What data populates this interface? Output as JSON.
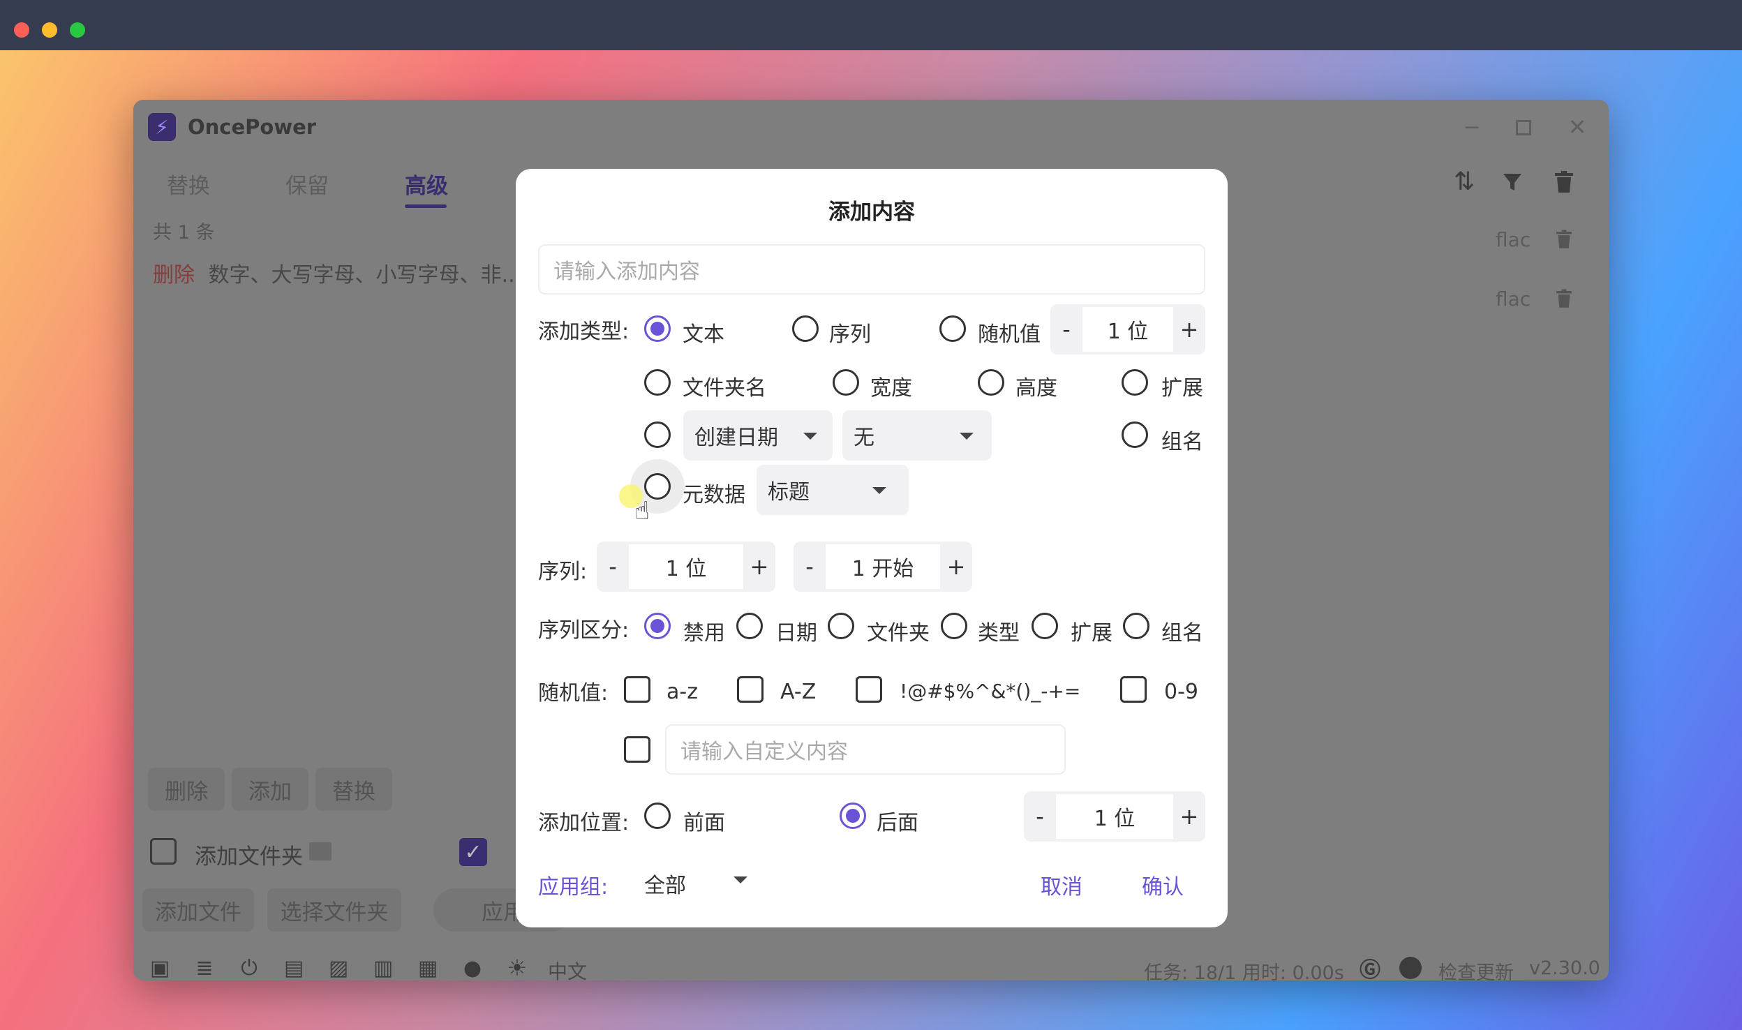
{
  "app": {
    "title": "OncePower",
    "tabs": [
      "替换",
      "保留",
      "高级"
    ],
    "count_text": "共 1 条",
    "rule": {
      "tag": "删除",
      "text": "数字、大写字母、小写字母、非..."
    },
    "file_ext_1": "flac",
    "file_ext_2": "flac",
    "action_buttons": [
      "删除",
      "添加",
      "替换"
    ],
    "add_folder_label": "添加文件夹",
    "bottom_buttons": [
      "添加文件",
      "选择文件夹",
      "应用"
    ],
    "language": "中文",
    "status_text": "任务: 18/1 用时: 0.00s",
    "update_label": "检查更新",
    "version": "v2.30.0"
  },
  "dialog": {
    "title": "添加内容",
    "content_placeholder": "请输入添加内容",
    "add_type": {
      "label": "添加类型:",
      "text": "文本",
      "sequence": "序列",
      "random": "随机值",
      "random_digits": "1 位",
      "folder_name": "文件夹名",
      "width": "宽度",
      "height": "高度",
      "extension": "扩展",
      "date_select": "创建日期",
      "date_format_select": "无",
      "group_name": "组名",
      "metadata": "元数据",
      "metadata_select": "标题",
      "selected": "文本"
    },
    "sequence": {
      "label": "序列:",
      "digits": "1 位",
      "start": "1 开始",
      "minus": "-",
      "plus": "+"
    },
    "seq_partition": {
      "label": "序列区分:",
      "options": [
        "禁用",
        "日期",
        "文件夹",
        "类型",
        "扩展",
        "组名"
      ],
      "selected": "禁用"
    },
    "random": {
      "label": "随机值:",
      "options": [
        "a-z",
        "A-Z",
        "!@#$%^&*()_-+=",
        "0-9"
      ],
      "custom_placeholder": "请输入自定义内容"
    },
    "position": {
      "label": "添加位置:",
      "front": "前面",
      "back": "后面",
      "selected": "后面",
      "digits": "1 位"
    },
    "apply_group": {
      "label": "应用组:",
      "value": "全部"
    },
    "cancel": "取消",
    "confirm": "确认"
  },
  "colors": {
    "accent": "#6b52d6",
    "overlay_bg": "#7e7e7e",
    "titlebar": "#363c4f"
  }
}
